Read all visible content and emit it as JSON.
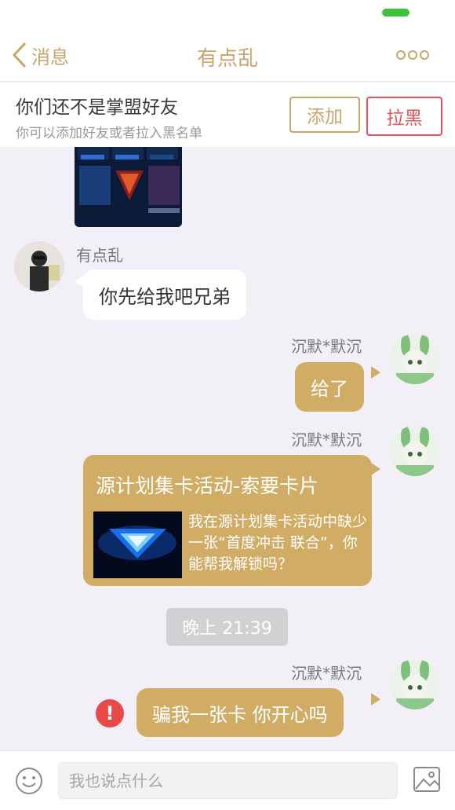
{
  "nav": {
    "back_label": "消息",
    "title": "有点乱"
  },
  "friend_bar": {
    "title": "你们还不是掌盟好友",
    "subtitle": "你可以添加好友或者拉入黑名单",
    "add_label": "添加",
    "block_label": "拉黑"
  },
  "messages": {
    "m1": {
      "sender": "有点乱",
      "text": "你先给我吧兄弟"
    },
    "m2": {
      "sender": "沉默*默沉",
      "text": "给了"
    },
    "m3": {
      "sender": "沉默*默沉",
      "card_title": "源计划集卡活动-索要卡片",
      "card_desc": "我在源计划集卡活动中缺少一张“首度冲击 联合”，你能帮我解锁吗？"
    },
    "timestamp": "晚上 21:39",
    "m4": {
      "sender": "沉默*默沉",
      "text": "骗我一张卡 你开心吗"
    }
  },
  "input": {
    "placeholder": "我也说点什么"
  },
  "colors": {
    "accent": "#c8a56a",
    "bubble_out": "#d1ac65",
    "danger": "#e8505a",
    "background": "#f3eff6"
  }
}
